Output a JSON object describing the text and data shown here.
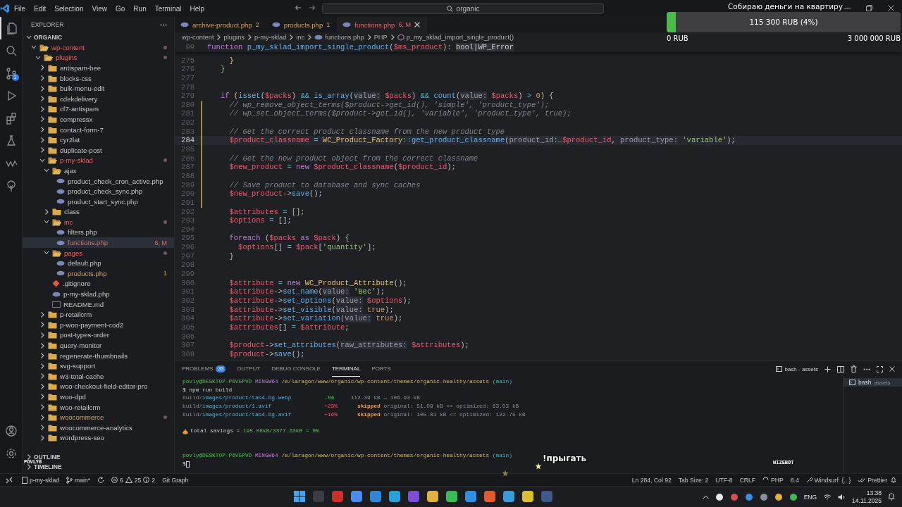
{
  "title_bar": {
    "menu": [
      "File",
      "Edit",
      "Selection",
      "View",
      "Go",
      "Run",
      "Terminal",
      "Help"
    ],
    "search": "organic"
  },
  "activity_bar": {
    "source_control_badge": "1"
  },
  "sidebar": {
    "title": "EXPLORER",
    "root": "ORGANIC",
    "sections": [
      "OUTLINE",
      "TIMELINE"
    ],
    "tree": [
      {
        "label": "wp-content",
        "kind": "folder",
        "expanded": true,
        "selected": false,
        "modified": true,
        "warning": false,
        "dot": true,
        "children": [
          {
            "label": "plugins",
            "kind": "folder",
            "expanded": true,
            "selected": false,
            "modified": true,
            "warning": false,
            "dot": true,
            "children": [
              {
                "label": "antispam-bee",
                "kind": "folder",
                "expanded": false,
                "selected": false,
                "modified": false,
                "warning": false,
                "dot": false
              },
              {
                "label": "blocks-css",
                "kind": "folder",
                "expanded": false,
                "selected": false,
                "modified": false,
                "warning": false,
                "dot": false
              },
              {
                "label": "bulk-menu-edit",
                "kind": "folder",
                "expanded": false,
                "selected": false,
                "modified": false,
                "warning": false,
                "dot": false
              },
              {
                "label": "cdekdelivery",
                "kind": "folder",
                "expanded": false,
                "selected": false,
                "modified": false,
                "warning": false,
                "dot": false
              },
              {
                "label": "cf7-antispam",
                "kind": "folder",
                "expanded": false,
                "selected": false,
                "modified": false,
                "warning": false,
                "dot": false
              },
              {
                "label": "compressx",
                "kind": "folder",
                "expanded": false,
                "selected": false,
                "modified": false,
                "warning": false,
                "dot": false
              },
              {
                "label": "contact-form-7",
                "kind": "folder",
                "expanded": false,
                "selected": false,
                "modified": false,
                "warning": false,
                "dot": false
              },
              {
                "label": "cyr2lat",
                "kind": "folder",
                "expanded": false,
                "selected": false,
                "modified": false,
                "warning": false,
                "dot": false
              },
              {
                "label": "duplicate-post",
                "kind": "folder",
                "expanded": false,
                "selected": false,
                "modified": false,
                "warning": false,
                "dot": false
              },
              {
                "label": "p-my-sklad",
                "kind": "folder",
                "expanded": true,
                "selected": false,
                "modified": true,
                "warning": false,
                "dot": true,
                "children": [
                  {
                    "label": "ajax",
                    "kind": "folder",
                    "expanded": true,
                    "selected": false,
                    "modified": false,
                    "warning": false,
                    "dot": false,
                    "children": [
                      {
                        "label": "product_check_cron_active.php",
                        "kind": "php",
                        "selected": false,
                        "modified": false,
                        "warning": false,
                        "dot": false
                      },
                      {
                        "label": "product_check_sync.php",
                        "kind": "php",
                        "selected": false,
                        "modified": false,
                        "warning": false,
                        "dot": false
                      },
                      {
                        "label": "product_start_sync.php",
                        "kind": "php",
                        "selected": false,
                        "modified": false,
                        "warning": false,
                        "dot": false
                      }
                    ]
                  },
                  {
                    "label": "class",
                    "kind": "folder",
                    "expanded": false,
                    "selected": false,
                    "modified": false,
                    "warning": false,
                    "dot": false
                  },
                  {
                    "label": "inc",
                    "kind": "folder",
                    "expanded": true,
                    "selected": false,
                    "modified": true,
                    "warning": false,
                    "dot": true,
                    "children": [
                      {
                        "label": "filters.php",
                        "kind": "php",
                        "selected": false,
                        "modified": false,
                        "warning": false,
                        "dot": false
                      },
                      {
                        "label": "functions.php",
                        "kind": "php",
                        "selected": true,
                        "modified": true,
                        "warning": false,
                        "dot": false,
                        "badge": "6, M"
                      }
                    ]
                  },
                  {
                    "label": "pages",
                    "kind": "folder",
                    "expanded": true,
                    "selected": false,
                    "modified": true,
                    "warning": false,
                    "dot": true,
                    "children": [
                      {
                        "label": "default.php",
                        "kind": "php",
                        "selected": false,
                        "modified": false,
                        "warning": false,
                        "dot": false
                      },
                      {
                        "label": "products.php",
                        "kind": "php",
                        "selected": false,
                        "modified": false,
                        "warning": true,
                        "dot": false,
                        "badge": "1"
                      }
                    ]
                  },
                  {
                    "label": ".gitignore",
                    "kind": "git",
                    "selected": false,
                    "modified": false,
                    "warning": false,
                    "dot": false
                  },
                  {
                    "label": "p-my-sklad.php",
                    "kind": "php",
                    "selected": false,
                    "modified": false,
                    "warning": false,
                    "dot": false
                  },
                  {
                    "label": "README.md",
                    "kind": "md",
                    "selected": false,
                    "modified": false,
                    "warning": false,
                    "dot": false
                  }
                ]
              },
              {
                "label": "p-retailcrm",
                "kind": "folder",
                "expanded": false,
                "selected": false,
                "modified": false,
                "warning": false,
                "dot": false
              },
              {
                "label": "p-woo-payment-cod2",
                "kind": "folder",
                "expanded": false,
                "selected": false,
                "modified": false,
                "warning": false,
                "dot": false
              },
              {
                "label": "post-types-order",
                "kind": "folder",
                "expanded": false,
                "selected": false,
                "modified": false,
                "warning": false,
                "dot": false
              },
              {
                "label": "query-monitor",
                "kind": "folder",
                "expanded": false,
                "selected": false,
                "modified": false,
                "warning": false,
                "dot": false
              },
              {
                "label": "regenerate-thumbnails",
                "kind": "folder",
                "expanded": false,
                "selected": false,
                "modified": false,
                "warning": false,
                "dot": false
              },
              {
                "label": "svg-support",
                "kind": "folder",
                "expanded": false,
                "selected": false,
                "modified": false,
                "warning": false,
                "dot": false
              },
              {
                "label": "w3-total-cache",
                "kind": "folder",
                "expanded": false,
                "selected": false,
                "modified": false,
                "warning": false,
                "dot": false
              },
              {
                "label": "woo-checkout-field-editor-pro",
                "kind": "folder",
                "expanded": false,
                "selected": false,
                "modified": false,
                "warning": false,
                "dot": false
              },
              {
                "label": "woo-dpd",
                "kind": "folder",
                "expanded": false,
                "selected": false,
                "modified": false,
                "warning": false,
                "dot": false
              },
              {
                "label": "woo-retailcrm",
                "kind": "folder",
                "expanded": false,
                "selected": false,
                "modified": false,
                "warning": false,
                "dot": false
              },
              {
                "label": "woocommerce",
                "kind": "folder",
                "expanded": false,
                "selected": false,
                "modified": false,
                "warning": true,
                "dot": true
              },
              {
                "label": "woocommerce-analytics",
                "kind": "folder",
                "expanded": false,
                "selected": false,
                "modified": false,
                "warning": false,
                "dot": false
              },
              {
                "label": "wordpress-seo",
                "kind": "folder",
                "expanded": false,
                "selected": false,
                "modified": false,
                "warning": false,
                "dot": false
              }
            ]
          }
        ]
      }
    ]
  },
  "editor": {
    "tabs": [
      {
        "label": "archive-product.php",
        "badge": "2",
        "selected": false,
        "modified": false,
        "warning": true
      },
      {
        "label": "products.php",
        "badge": "1",
        "selected": false,
        "modified": false,
        "warning": true
      },
      {
        "label": "functions.php",
        "badge": "6, M",
        "selected": true,
        "modified": true,
        "warning": false
      }
    ],
    "breadcrumbs": [
      {
        "label": "wp-content",
        "kind": "folder"
      },
      {
        "label": "plugins",
        "kind": "folder"
      },
      {
        "label": "p-my-sklad",
        "kind": "folder"
      },
      {
        "label": "inc",
        "kind": "folder"
      },
      {
        "label": "functions.php",
        "kind": "file"
      },
      {
        "label": "PHP",
        "kind": "folder"
      },
      {
        "label": "p_my_sklad_import_single_product()",
        "kind": "symbol"
      }
    ],
    "sticky": {
      "num": "99",
      "tokens": [
        {
          "kind": "kw",
          "text": "function "
        },
        {
          "kind": "fn",
          "text": "p_my_sklad_import_single_product"
        },
        {
          "kind": "p",
          "text": "("
        },
        {
          "kind": "var",
          "text": "$ms_product"
        },
        {
          "kind": "p",
          "text": "): "
        },
        {
          "kind": "type",
          "text": "bool|WP_Error"
        }
      ]
    },
    "lines": [
      {
        "num": "275",
        "current": false,
        "changed": false,
        "tokens": [
          {
            "kind": "br1",
            "text": "     }"
          }
        ]
      },
      {
        "num": "276",
        "current": false,
        "changed": false,
        "tokens": [
          {
            "kind": "br2",
            "text": "   }"
          }
        ]
      },
      {
        "num": "277",
        "current": false,
        "changed": false
      },
      {
        "num": "278",
        "current": false,
        "changed": false
      },
      {
        "num": "279",
        "current": false,
        "changed": false,
        "tokens": [
          {
            "kind": "kw",
            "text": "   if "
          },
          {
            "kind": "br1",
            "text": "("
          },
          {
            "kind": "fn",
            "text": "isset"
          },
          {
            "kind": "p",
            "text": "("
          },
          {
            "kind": "var",
            "text": "$packs"
          },
          {
            "kind": "p",
            "text": ") "
          },
          {
            "kind": "op",
            "text": "&& "
          },
          {
            "kind": "fn",
            "text": "is_array"
          },
          {
            "kind": "p",
            "text": "("
          },
          {
            "kind": "hint",
            "text": "value:"
          },
          {
            "kind": "var",
            "text": " $packs"
          },
          {
            "kind": "p",
            "text": ") "
          },
          {
            "kind": "op",
            "text": "&& "
          },
          {
            "kind": "fn",
            "text": "count"
          },
          {
            "kind": "p",
            "text": "("
          },
          {
            "kind": "hint",
            "text": "value:"
          },
          {
            "kind": "var",
            "text": " $packs"
          },
          {
            "kind": "p",
            "text": ") "
          },
          {
            "kind": "op",
            "text": "> "
          },
          {
            "kind": "num",
            "text": "0"
          },
          {
            "kind": "br1",
            "text": ")"
          },
          {
            "kind": "p",
            "text": " {"
          }
        ]
      },
      {
        "num": "280",
        "current": false,
        "changed": true,
        "tokens": [
          {
            "kind": "cm",
            "text": "     // wp_remove_object_terms($product->get_id(), 'simple', 'product_type');"
          }
        ]
      },
      {
        "num": "281",
        "current": false,
        "changed": true,
        "tokens": [
          {
            "kind": "cm",
            "text": "     // wp_set_object_terms($product->get_id(), 'variable', 'product_type', true);"
          }
        ]
      },
      {
        "num": "282",
        "current": false,
        "changed": true
      },
      {
        "num": "283",
        "current": false,
        "changed": true,
        "tokens": [
          {
            "kind": "cm",
            "text": "     // Get the correct product classname from the new product type"
          }
        ]
      },
      {
        "num": "284",
        "current": true,
        "changed": true,
        "tokens": [
          {
            "kind": "var",
            "text": "     $product_classname"
          },
          {
            "kind": "op",
            "text": " = "
          },
          {
            "kind": "cls",
            "text": "WC_Product_Factory"
          },
          {
            "kind": "op",
            "text": "::"
          },
          {
            "kind": "fn",
            "text": "get_product_classname"
          },
          {
            "kind": "p",
            "text": "("
          },
          {
            "kind": "hint",
            "text": "product_id:…"
          },
          {
            "kind": "var",
            "text": "$product_id"
          },
          {
            "kind": "p",
            "text": ", "
          },
          {
            "kind": "hint",
            "text": "product_type:"
          },
          {
            "kind": "str",
            "text": " 'variable'"
          },
          {
            "kind": "p",
            "text": ");"
          }
        ]
      },
      {
        "num": "285",
        "current": false,
        "changed": true
      },
      {
        "num": "286",
        "current": false,
        "changed": true,
        "tokens": [
          {
            "kind": "cm",
            "text": "     // Get the new product object from the correct classname"
          }
        ]
      },
      {
        "num": "287",
        "current": false,
        "changed": true,
        "tokens": [
          {
            "kind": "var",
            "text": "     $new_product"
          },
          {
            "kind": "op",
            "text": " = "
          },
          {
            "kind": "kw",
            "text": "new "
          },
          {
            "kind": "var",
            "text": "$product_classname"
          },
          {
            "kind": "p",
            "text": "("
          },
          {
            "kind": "var",
            "text": "$product_id"
          },
          {
            "kind": "p",
            "text": ");"
          }
        ]
      },
      {
        "num": "288",
        "current": false,
        "changed": true
      },
      {
        "num": "289",
        "current": false,
        "changed": true,
        "tokens": [
          {
            "kind": "cm",
            "text": "     // Save product to database and sync caches"
          }
        ]
      },
      {
        "num": "290",
        "current": false,
        "changed": true,
        "tokens": [
          {
            "kind": "var",
            "text": "     $new_product"
          },
          {
            "kind": "p",
            "text": "->"
          },
          {
            "kind": "fn",
            "text": "save"
          },
          {
            "kind": "p",
            "text": "();"
          }
        ]
      },
      {
        "num": "291",
        "current": false,
        "changed": true
      },
      {
        "num": "292",
        "current": false,
        "changed": false,
        "tokens": [
          {
            "kind": "var",
            "text": "     $attributes"
          },
          {
            "kind": "op",
            "text": " = "
          },
          {
            "kind": "p",
            "text": "[];"
          }
        ]
      },
      {
        "num": "293",
        "current": false,
        "changed": false,
        "tokens": [
          {
            "kind": "var",
            "text": "     $options"
          },
          {
            "kind": "op",
            "text": " = "
          },
          {
            "kind": "p",
            "text": "[];"
          }
        ]
      },
      {
        "num": "294",
        "current": false,
        "changed": false
      },
      {
        "num": "295",
        "current": false,
        "changed": false,
        "tokens": [
          {
            "kind": "kw",
            "text": "     foreach "
          },
          {
            "kind": "p",
            "text": "("
          },
          {
            "kind": "var",
            "text": "$packs"
          },
          {
            "kind": "kw",
            "text": " as "
          },
          {
            "kind": "var",
            "text": "$pack"
          },
          {
            "kind": "p",
            "text": ") {"
          }
        ]
      },
      {
        "num": "296",
        "current": false,
        "changed": false,
        "tokens": [
          {
            "kind": "var",
            "text": "       $options"
          },
          {
            "kind": "p",
            "text": "[] "
          },
          {
            "kind": "op",
            "text": "= "
          },
          {
            "kind": "var",
            "text": "$pack"
          },
          {
            "kind": "p",
            "text": "["
          },
          {
            "kind": "str",
            "text": "'quantity'"
          },
          {
            "kind": "p",
            "text": "];"
          }
        ]
      },
      {
        "num": "297",
        "current": false,
        "changed": false,
        "tokens": [
          {
            "kind": "p",
            "text": "     }"
          }
        ]
      },
      {
        "num": "298",
        "current": false,
        "changed": false
      },
      {
        "num": "299",
        "current": false,
        "changed": false
      },
      {
        "num": "300",
        "current": false,
        "changed": false,
        "tokens": [
          {
            "kind": "var",
            "text": "     $attribute"
          },
          {
            "kind": "op",
            "text": " = "
          },
          {
            "kind": "kw",
            "text": "new "
          },
          {
            "kind": "cls",
            "text": "WC_Product_Attribute"
          },
          {
            "kind": "p",
            "text": "();"
          }
        ]
      },
      {
        "num": "301",
        "current": false,
        "changed": false,
        "tokens": [
          {
            "kind": "var",
            "text": "     $attribute"
          },
          {
            "kind": "p",
            "text": "->"
          },
          {
            "kind": "fn",
            "text": "set_name"
          },
          {
            "kind": "p",
            "text": "("
          },
          {
            "kind": "hint",
            "text": "value:"
          },
          {
            "kind": "str",
            "text": " 'Вес'"
          },
          {
            "kind": "p",
            "text": ");"
          }
        ]
      },
      {
        "num": "302",
        "current": false,
        "changed": false,
        "tokens": [
          {
            "kind": "var",
            "text": "     $attribute"
          },
          {
            "kind": "p",
            "text": "->"
          },
          {
            "kind": "fn",
            "text": "set_options"
          },
          {
            "kind": "p",
            "text": "("
          },
          {
            "kind": "hint",
            "text": "value:"
          },
          {
            "kind": "var",
            "text": " $options"
          },
          {
            "kind": "p",
            "text": ");"
          }
        ]
      },
      {
        "num": "303",
        "current": false,
        "changed": false,
        "tokens": [
          {
            "kind": "var",
            "text": "     $attribute"
          },
          {
            "kind": "p",
            "text": "->"
          },
          {
            "kind": "fn",
            "text": "set_visible"
          },
          {
            "kind": "p",
            "text": "("
          },
          {
            "kind": "hint",
            "text": "value:"
          },
          {
            "kind": "num",
            "text": " true"
          },
          {
            "kind": "p",
            "text": ");"
          }
        ]
      },
      {
        "num": "304",
        "current": false,
        "changed": false,
        "tokens": [
          {
            "kind": "var",
            "text": "     $attribute"
          },
          {
            "kind": "p",
            "text": "->"
          },
          {
            "kind": "fn",
            "text": "set_variation"
          },
          {
            "kind": "p",
            "text": "("
          },
          {
            "kind": "hint",
            "text": "value:"
          },
          {
            "kind": "num",
            "text": " true"
          },
          {
            "kind": "p",
            "text": ");"
          }
        ]
      },
      {
        "num": "305",
        "current": false,
        "changed": false,
        "tokens": [
          {
            "kind": "var",
            "text": "     $attributes"
          },
          {
            "kind": "p",
            "text": "[] "
          },
          {
            "kind": "op",
            "text": "= "
          },
          {
            "kind": "var",
            "text": "$attribute"
          },
          {
            "kind": "p",
            "text": ";"
          }
        ]
      },
      {
        "num": "306",
        "current": false,
        "changed": false
      },
      {
        "num": "307",
        "current": false,
        "changed": false,
        "tokens": [
          {
            "kind": "var",
            "text": "     $product"
          },
          {
            "kind": "p",
            "text": "->"
          },
          {
            "kind": "fn",
            "text": "set_attributes"
          },
          {
            "kind": "p",
            "text": "("
          },
          {
            "kind": "hint",
            "text": "raw_attributes:"
          },
          {
            "kind": "var",
            "text": " $attributes"
          },
          {
            "kind": "p",
            "text": ");"
          }
        ]
      },
      {
        "num": "308",
        "current": false,
        "changed": false,
        "tokens": [
          {
            "kind": "var",
            "text": "     $product"
          },
          {
            "kind": "p",
            "text": "->"
          },
          {
            "kind": "fn",
            "text": "save"
          },
          {
            "kind": "p",
            "text": "();"
          }
        ]
      }
    ]
  },
  "panel": {
    "tabs": [
      {
        "label": "PROBLEMS",
        "badge": "33",
        "selected": false
      },
      {
        "label": "OUTPUT",
        "selected": false
      },
      {
        "label": "DEBUG CONSOLE",
        "selected": false
      },
      {
        "label": "TERMINAL",
        "selected": true
      },
      {
        "label": "PORTS",
        "selected": false
      }
    ],
    "terminal_name": "bash - assets",
    "terminal_list": [
      {
        "name": "bash",
        "detail": "assets",
        "selected": true
      }
    ],
    "lines": [
      {
        "kind": "text",
        "tokens": [
          {
            "kind": "green",
            "text": "povly@DESKTOP-P6V5PVD"
          },
          {
            "kind": "purple",
            "text": " MINGW64"
          },
          {
            "kind": "yellow",
            "text": " /e/laragon/www/organic/wp-content/themes/organic-healthy/assets"
          },
          {
            "kind": "cyan",
            "text": " (main)"
          }
        ]
      },
      {
        "kind": "text",
        "tokens": [
          {
            "kind": "w",
            "text": "$ npm run build"
          }
        ]
      },
      {
        "kind": "text",
        "tokens": [
          {
            "kind": "dim",
            "text": "build/"
          },
          {
            "kind": "blue",
            "text": "images/product/tab4-bg.webp"
          },
          {
            "kind": "good",
            "text": "          -5%"
          },
          {
            "kind": "dim",
            "text": "     112.39 kB → 106.93 kB"
          }
        ]
      },
      {
        "kind": "text",
        "tokens": [
          {
            "kind": "dim",
            "text": "build/"
          },
          {
            "kind": "blue",
            "text": "images/product/1.avif"
          },
          {
            "kind": "bad",
            "text": "                +23%"
          },
          {
            "kind": "warn",
            "text": "      skipped"
          },
          {
            "kind": "dim",
            "text": " original: 51.09 kB <= optimized: 63.03 kB"
          }
        ]
      },
      {
        "kind": "text",
        "tokens": [
          {
            "kind": "dim",
            "text": "build/"
          },
          {
            "kind": "blue",
            "text": "images/product/tab4-bg.avif"
          },
          {
            "kind": "bad",
            "text": "          +16%"
          },
          {
            "kind": "warn",
            "text": "      skipped"
          },
          {
            "kind": "dim",
            "text": " original: 105.81 kB <= optimized: 122.75 kB"
          }
        ]
      },
      {
        "kind": "blank"
      },
      {
        "kind": "savings",
        "tokens": [
          {
            "kind": "w",
            "text": "total savings = "
          },
          {
            "kind": "good",
            "text": "195.08kB/3377.63kB ≈ 6%"
          }
        ]
      },
      {
        "kind": "blank"
      },
      {
        "kind": "blank"
      },
      {
        "kind": "text",
        "tokens": [
          {
            "kind": "green",
            "text": "povly@DESKTOP-P6V5PVD"
          },
          {
            "kind": "purple",
            "text": " MINGW64"
          },
          {
            "kind": "yellow",
            "text": " /e/laragon/www/organic/wp-content/themes/organic-healthy/assets"
          },
          {
            "kind": "cyan",
            "text": " (main)"
          }
        ]
      },
      {
        "kind": "prompt",
        "tokens": [
          {
            "kind": "w",
            "text": "$"
          }
        ]
      }
    ]
  },
  "status_bar": {
    "project": "p-my-sklad",
    "branch": "main*",
    "errors": "6",
    "warnings": "25",
    "infos": "2",
    "git_graph": "Git Graph",
    "position": "Ln 284, Col 92",
    "tab_size": "Tab Size: 2",
    "encoding": "UTF-8",
    "eol": "CRLF",
    "language": "PHP",
    "php_version": "8.4",
    "windsurf": "Windsurf: {...}",
    "prettier": "Prettier"
  },
  "donation": {
    "title": "Собираю деньги на квартиру",
    "amount": "115 300 RUB (4%)",
    "level": 0.04,
    "min": "0 RUB",
    "max": "3 000 000 RUB"
  },
  "stream_overlay": {
    "command": "!прыгать",
    "bot": "WIZEBOT",
    "nickname": "POVLY0"
  },
  "taskbar": {
    "language": "ENG",
    "time": "13:38",
    "date": "14.11.2025"
  }
}
